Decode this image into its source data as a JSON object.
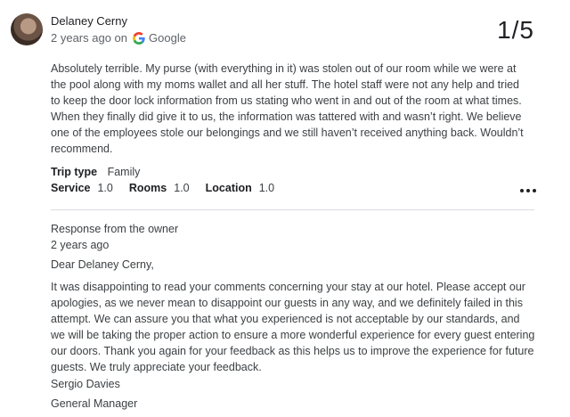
{
  "reviewer": {
    "name": "Delaney Cerny",
    "time": "2 years ago on",
    "source": "Google"
  },
  "counter": "1/5",
  "review": {
    "text": "Absolutely terrible. My purse (with everything in it) was stolen out of our room while we were at the pool along with my moms wallet and all her stuff. The hotel staff were not any help and tried to keep the door lock information from us stating who went in and out of the room at what times. When they finally did give it to us, the information was tattered with and wasn’t right. We believe one of the employees stole our belongings and we still haven’t received anything back. Wouldn’t recommend.",
    "trip_type_label": "Trip type",
    "trip_type_value": "Family",
    "ratings": [
      {
        "label": "Service",
        "value": "1.0"
      },
      {
        "label": "Rooms",
        "value": "1.0"
      },
      {
        "label": "Location",
        "value": "1.0"
      }
    ]
  },
  "icons": {
    "more": "more-horizontal-icon",
    "google": "google-g-icon"
  },
  "colors": {
    "google_blue": "#4285F4",
    "google_red": "#EA4335",
    "google_yellow": "#FBBC05",
    "google_green": "#34A853"
  },
  "response": {
    "label": "Response from the owner",
    "time": "2 years ago",
    "greeting": "Dear Delaney Cerny,",
    "body": "It was disappointing to read your comments concerning your stay at our hotel. Please accept our apologies, as we never mean to disappoint our guests in any way, and we definitely failed in this attempt. We can assure you that what you experienced is not acceptable by our standards, and we will be taking the proper action to ensure a more wonderful experience for every guest entering our doors. Thank you again for your feedback as this helps us to improve the experience for future guests. We truly appreciate your feedback.",
    "signer": "Sergio Davies",
    "signer_title": "General Manager"
  }
}
